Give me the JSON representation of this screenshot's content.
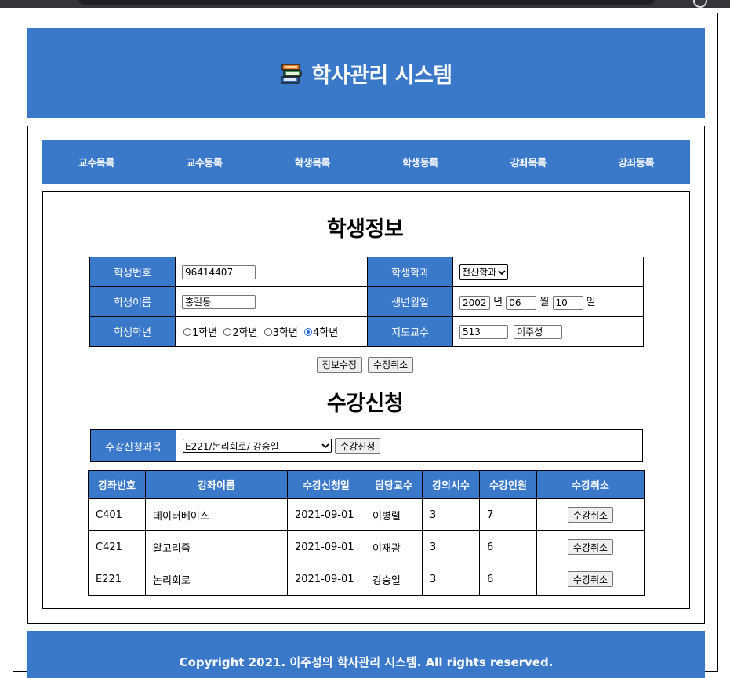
{
  "header": {
    "title": "학사관리 시스템",
    "icon": "books-icon"
  },
  "nav": {
    "items": [
      "교수목록",
      "교수등록",
      "학생목록",
      "학생등록",
      "강좌목록",
      "강좌등록"
    ]
  },
  "student_info": {
    "section_title": "학생정보",
    "labels": {
      "student_number": "학생번호",
      "department": "학생학과",
      "name": "학생이름",
      "birth_date": "생년월일",
      "grade": "학생학년",
      "advisor": "지도교수"
    },
    "values": {
      "student_number": "96414407",
      "department": "전산학과",
      "name": "홍길동",
      "birth_year": "2002",
      "year_suffix": "년",
      "birth_month": "06",
      "month_suffix": "월",
      "birth_day": "10",
      "day_suffix": "일",
      "advisor_code": "513",
      "advisor_name": "이주성"
    },
    "grades": [
      "1학년",
      "2학년",
      "3학년",
      "4학년"
    ],
    "selected_grade": "4학년",
    "buttons": {
      "update": "정보수정",
      "cancel_update": "수정취소"
    }
  },
  "enrollment": {
    "section_title": "수강신청",
    "label": "수강신청과목",
    "selected_course": "E221/논리회로/ 강승일",
    "submit_label": "수강신청",
    "columns": [
      "강좌번호",
      "강좌이름",
      "수강신청일",
      "담당교수",
      "강의시수",
      "수강인원",
      "수강취소"
    ],
    "rows": [
      {
        "code": "C401",
        "name": "데이터베이스",
        "date": "2021-09-01",
        "professor": "이병렬",
        "hours": "3",
        "count": "7",
        "action": "수강취소"
      },
      {
        "code": "C421",
        "name": "알고리즘",
        "date": "2021-09-01",
        "professor": "이재광",
        "hours": "3",
        "count": "6",
        "action": "수강취소"
      },
      {
        "code": "E221",
        "name": "논리회로",
        "date": "2021-09-01",
        "professor": "강승일",
        "hours": "3",
        "count": "6",
        "action": "수강취소"
      }
    ]
  },
  "footer": {
    "text": "Copyright 2021. 이주성의 학사관리 시스템. All rights reserved."
  },
  "colors": {
    "primary": "#3a78c9",
    "text_on_primary": "#ffffff",
    "border": "#000000"
  }
}
